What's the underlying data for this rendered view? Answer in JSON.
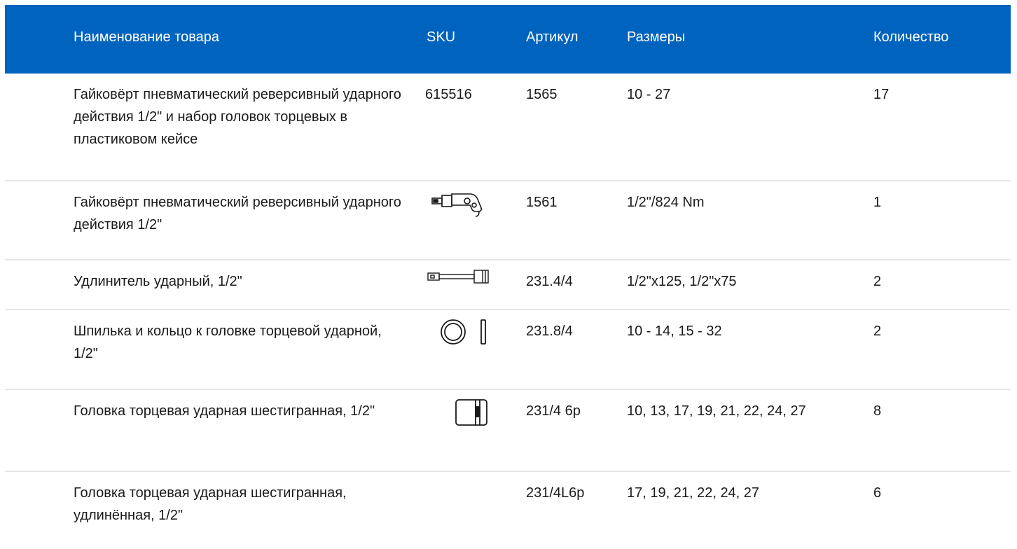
{
  "header": {
    "columns": [
      "Наименование товара",
      "SKU",
      "Артикул",
      "Размеры",
      "Количество"
    ]
  },
  "rows": [
    {
      "name": "Гайковёрт пневматический реверсивный ударного действия 1/2\" и набор головок торцевых в пластиковом кейсе",
      "sku": "615516",
      "sku_icon": null,
      "article": "1565",
      "size": "10 - 27",
      "qty": "17"
    },
    {
      "name": "Гайковёрт пневматический реверсивный ударного действия 1/2\"",
      "sku": "",
      "sku_icon": "impact-wrench-icon",
      "article": "1561",
      "size": "1/2\"/824 Nm",
      "qty": "1"
    },
    {
      "name": "Удлинитель ударный, 1/2\"",
      "sku": "",
      "sku_icon": "extension-bar-icon",
      "article": "231.4/4",
      "size": "1/2\"x125, 1/2\"x75",
      "qty": "2"
    },
    {
      "name": "Шпилька и кольцо к головке торцевой ударной, 1/2\"",
      "sku": "",
      "sku_icon": "ring-and-pin-icon",
      "article": "231.8/4",
      "size": "10 - 14, 15 - 32",
      "qty": "2"
    },
    {
      "name": "Головка торцевая ударная шестигранная, 1/2\"",
      "sku": "",
      "sku_icon": "socket-icon",
      "article": "231/4 6p",
      "size": "10, 13, 17, 19, 21, 22, 24, 27",
      "qty": "8"
    },
    {
      "name": "Головка торцевая ударная шестигранная, удлинённая, 1/2\"",
      "sku": "",
      "sku_icon": null,
      "article": "231/4L6p",
      "size": "17, 19, 21, 22, 24, 27",
      "qty": "6"
    }
  ],
  "colors": {
    "header_bg": "#0063be",
    "header_text": "#ffffff",
    "divider": "#e6e6e6"
  }
}
